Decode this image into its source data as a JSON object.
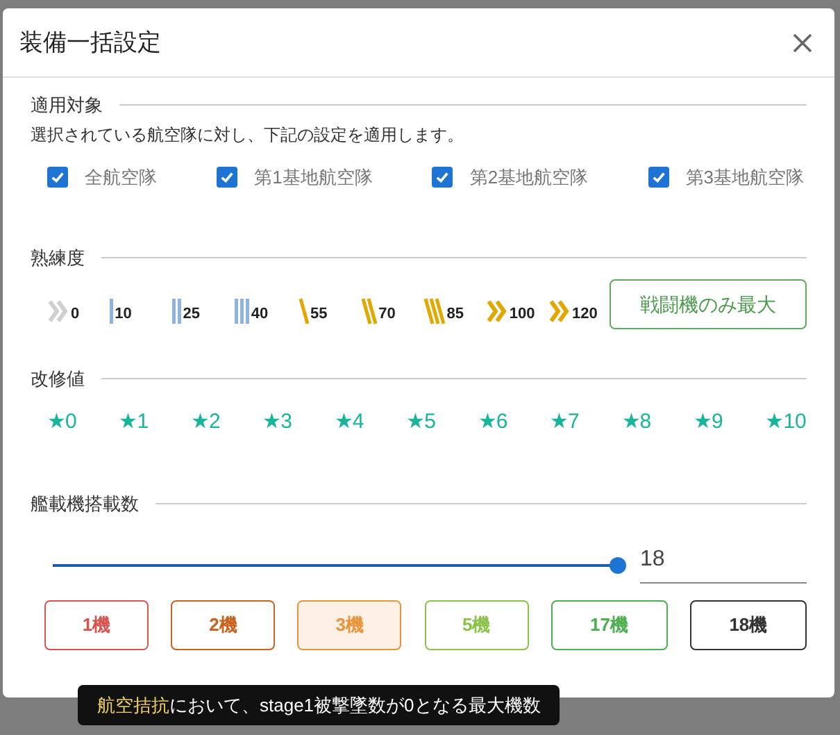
{
  "dialog": {
    "title": "装備一括設定"
  },
  "target": {
    "heading": "適用対象",
    "description": "選択されている航空隊に対し、下記の設定を適用します。",
    "checkboxes": [
      {
        "label": "全航空隊",
        "checked": true
      },
      {
        "label": "第1基地航空隊",
        "checked": true
      },
      {
        "label": "第2基地航空隊",
        "checked": true
      },
      {
        "label": "第3基地航空隊",
        "checked": true
      }
    ]
  },
  "proficiency": {
    "heading": "熟練度",
    "levels": [
      {
        "kind": "chevron-gray",
        "label": "0"
      },
      {
        "kind": "bar1",
        "label": "10"
      },
      {
        "kind": "bar2",
        "label": "25"
      },
      {
        "kind": "bar3",
        "label": "40"
      },
      {
        "kind": "slash1",
        "label": "55"
      },
      {
        "kind": "slash2",
        "label": "70"
      },
      {
        "kind": "slash3",
        "label": "85"
      },
      {
        "kind": "chevron-gold",
        "label": "100"
      },
      {
        "kind": "chevron-gold",
        "label": "120"
      }
    ],
    "max_button": "戦闘機のみ最大"
  },
  "improvement": {
    "heading": "改修値",
    "values": [
      "★0",
      "★1",
      "★2",
      "★3",
      "★4",
      "★5",
      "★6",
      "★7",
      "★8",
      "★9",
      "★10"
    ]
  },
  "slots": {
    "heading": "艦載機搭載数",
    "slider": {
      "level": 1.0
    },
    "value": "18",
    "presets": [
      {
        "label": "1機",
        "color": "#d9534f",
        "selected": false
      },
      {
        "label": "2機",
        "color": "#c8621e",
        "selected": false
      },
      {
        "label": "3機",
        "color": "#e8943a",
        "selected": true
      },
      {
        "label": "5機",
        "color": "#8bc34a",
        "selected": false
      },
      {
        "label": "17機",
        "color": "#4caf50",
        "selected": false
      },
      {
        "label": "18機",
        "color": "#333333",
        "selected": false
      }
    ]
  },
  "tooltip": "**航空拮抗**において、stage1被撃墜数が0となる最大機数"
}
